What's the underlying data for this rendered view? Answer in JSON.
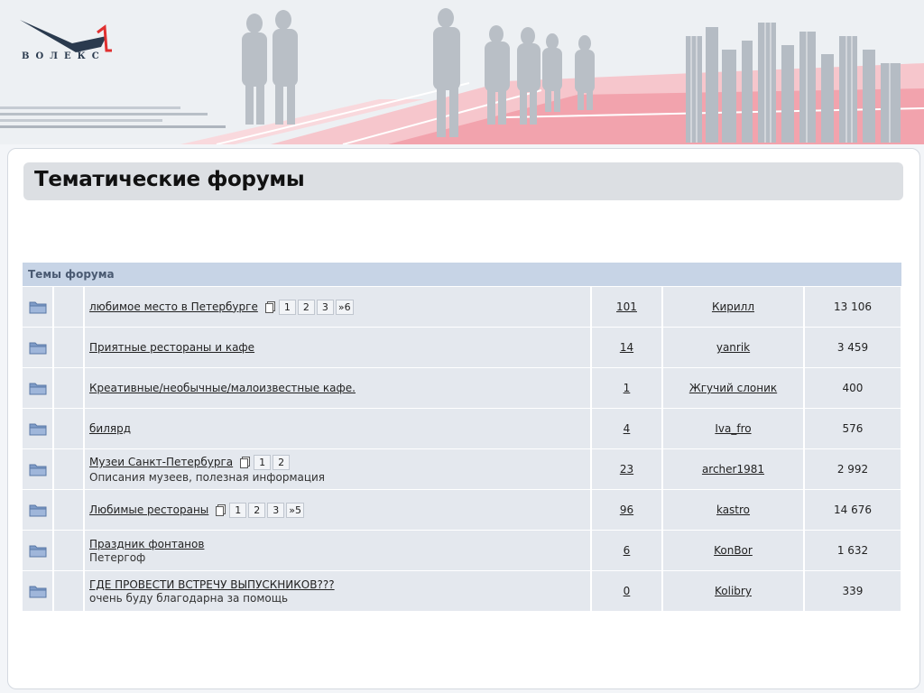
{
  "brand": {
    "logo_text": "ВОЛЕКС"
  },
  "page": {
    "title": "Тематические форумы"
  },
  "forum": {
    "header": "Темы форума",
    "topics": [
      {
        "title": "любимое место в Петербурге",
        "desc": "",
        "pages": [
          "1",
          "2",
          "3",
          "»6"
        ],
        "replies": "101",
        "author": "Кирилл",
        "views": "13 106"
      },
      {
        "title": "Приятные рестораны и кафе",
        "desc": "",
        "pages": [],
        "replies": "14",
        "author": "yanrik",
        "views": "3 459"
      },
      {
        "title": "Креативные/необычные/малоизвестные кафе.",
        "desc": "",
        "pages": [],
        "replies": "1",
        "author": "Жгучий слоник",
        "views": "400"
      },
      {
        "title": "билярд",
        "desc": "",
        "pages": [],
        "replies": "4",
        "author": "Iva_fro",
        "views": "576"
      },
      {
        "title": "Музеи Санкт-Петербурга",
        "desc": "Описания музеев, полезная информация",
        "pages": [
          "1",
          "2"
        ],
        "replies": "23",
        "author": "archer1981",
        "views": "2 992"
      },
      {
        "title": "Любимые рестораны",
        "desc": "",
        "pages": [
          "1",
          "2",
          "3",
          "»5"
        ],
        "replies": "96",
        "author": "kastro",
        "views": "14 676"
      },
      {
        "title": "Праздник фонтанов",
        "desc": "Петергоф",
        "pages": [],
        "replies": "6",
        "author": "KonBor",
        "views": "1 632"
      },
      {
        "title": "ГДЕ ПРОВЕСТИ ВСТРЕЧУ ВЫПУСКНИКОВ???",
        "desc": "очень буду благодарна за помощь",
        "pages": [],
        "replies": "0",
        "author": "Kolibry",
        "views": "339"
      }
    ]
  },
  "colors": {
    "header_bar": "#c7d4e6",
    "row_bg": "#e4e8ee",
    "title_bar": "#dcdfe3",
    "pink_accent": "#f2a3ad"
  }
}
